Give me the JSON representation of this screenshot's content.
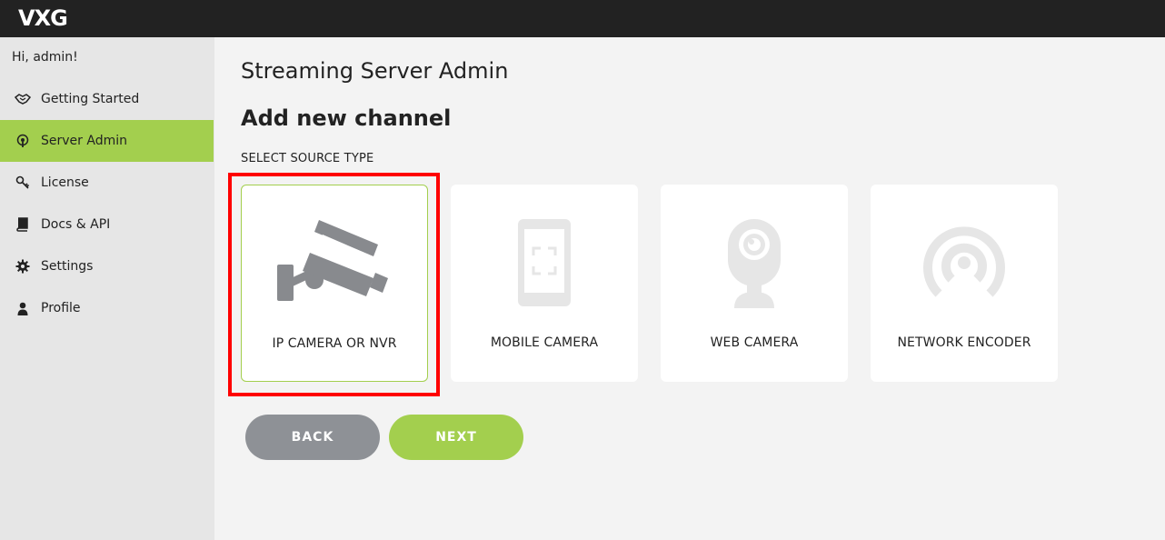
{
  "header": {
    "logo": "VXG"
  },
  "sidebar": {
    "greeting": "Hi, admin!",
    "items": [
      {
        "label": "Getting Started",
        "icon": "handshake-icon",
        "active": false
      },
      {
        "label": "Server Admin",
        "icon": "broadcast-icon",
        "active": true
      },
      {
        "label": "License",
        "icon": "key-icon",
        "active": false
      },
      {
        "label": "Docs & API",
        "icon": "book-icon",
        "active": false
      },
      {
        "label": "Settings",
        "icon": "gear-icon",
        "active": false
      },
      {
        "label": "Profile",
        "icon": "user-icon",
        "active": false
      }
    ]
  },
  "main": {
    "title": "Streaming Server Admin",
    "section_title": "Add new channel",
    "select_label": "SELECT SOURCE TYPE",
    "source_types": [
      {
        "label": "IP CAMERA OR NVR",
        "icon": "cctv-camera-icon",
        "selected": true
      },
      {
        "label": "MOBILE CAMERA",
        "icon": "smartphone-icon",
        "selected": false
      },
      {
        "label": "WEB CAMERA",
        "icon": "webcam-icon",
        "selected": false
      },
      {
        "label": "NETWORK ENCODER",
        "icon": "network-encoder-icon",
        "selected": false
      }
    ],
    "buttons": {
      "back": "BACK",
      "next": "NEXT"
    }
  },
  "colors": {
    "accent": "#a3cf4e",
    "topbar": "#222222",
    "sidebar_bg": "#e6e6e6",
    "back_button": "#8e9196",
    "highlight": "#ff0000"
  }
}
